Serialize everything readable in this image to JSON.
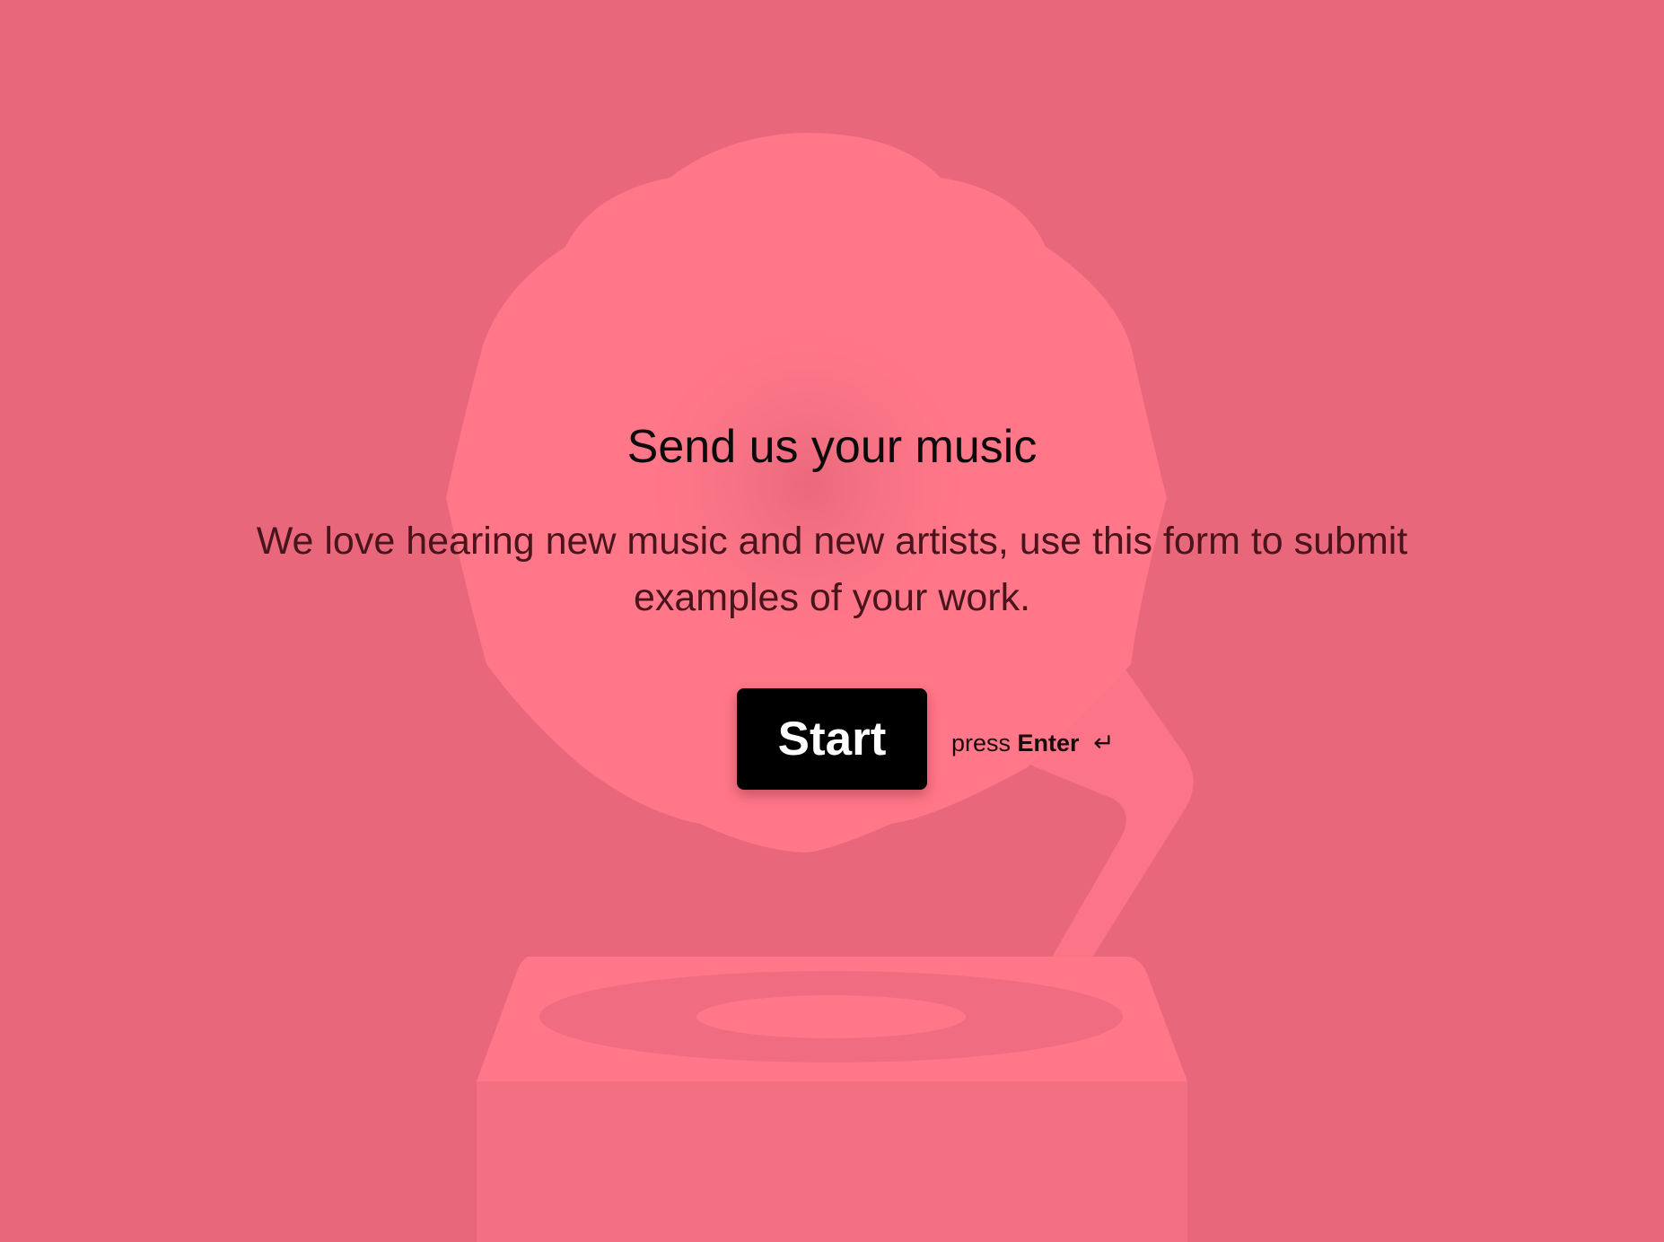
{
  "colors": {
    "background": "#E9677B",
    "illustration": "#FF7789",
    "illustration_dark": "#F27082",
    "button_background": "#000000",
    "button_text": "#FFFFFF"
  },
  "illustration": {
    "icon": "gramophone-icon"
  },
  "welcome": {
    "title": "Send us your music",
    "description": "We love hearing new music and new artists, use this form to submit examples of your work."
  },
  "actions": {
    "start_label": "Start",
    "hint_prefix": "press",
    "hint_key": "Enter",
    "hint_icon": "↵"
  }
}
